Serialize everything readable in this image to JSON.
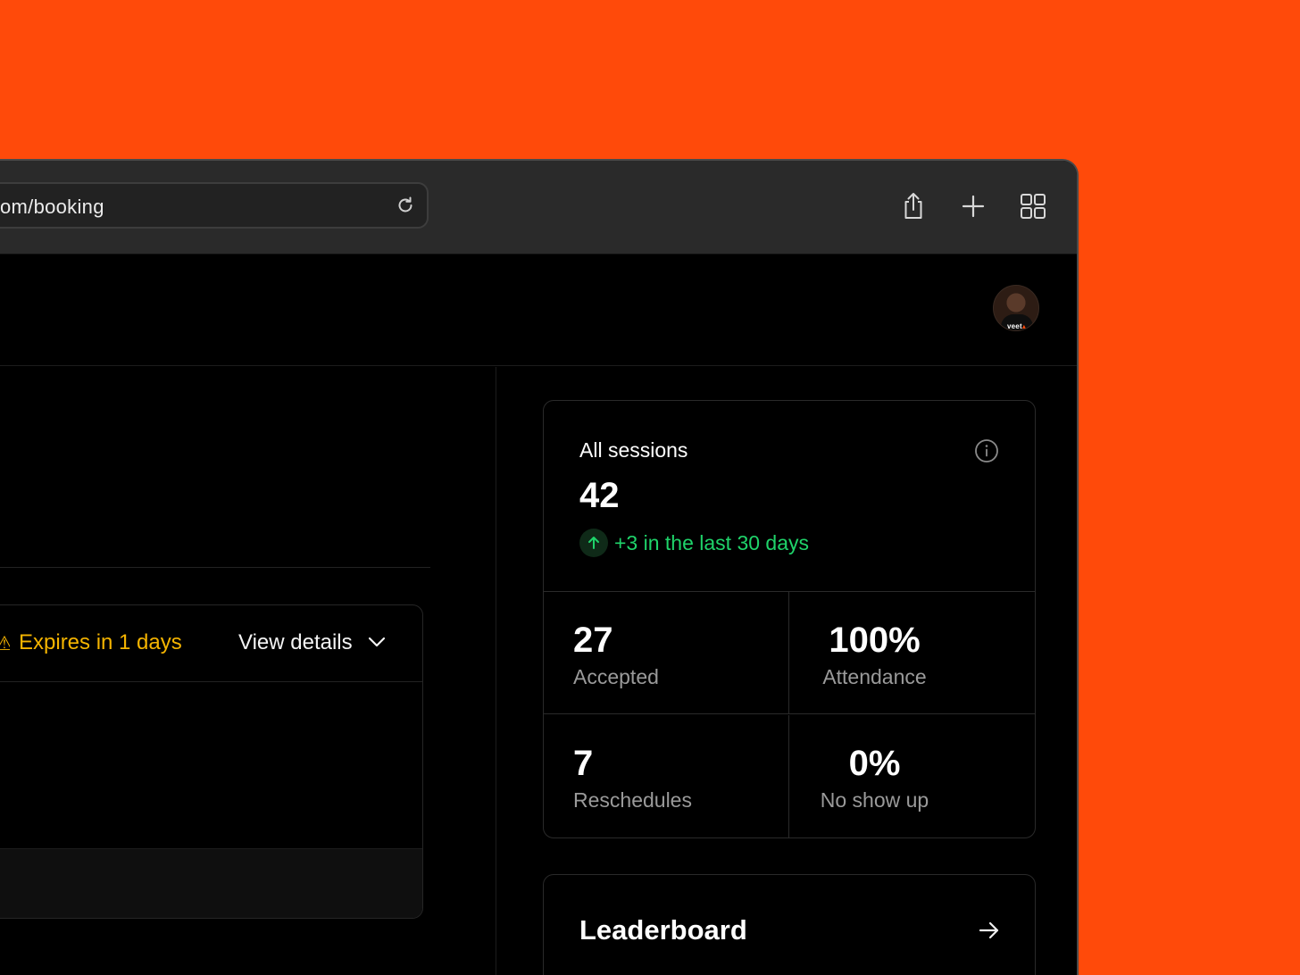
{
  "browser": {
    "url": "om/booking",
    "icons": [
      "reload-icon",
      "share-icon",
      "new-tab-icon",
      "tab-overview-icon"
    ]
  },
  "header": {
    "avatar_logo_text": "veet"
  },
  "offer": {
    "expires_text": "Expires in 1 days",
    "view_details_label": "View details",
    "accent_color": "#f5b400"
  },
  "stats": {
    "title": "All sessions",
    "total": "42",
    "trend": "+3 in the last 30 days",
    "trend_color": "#1fd36a",
    "cells": [
      {
        "value": "27",
        "label": "Accepted"
      },
      {
        "value": "100%",
        "label": "Attendance"
      },
      {
        "value": "7",
        "label": "Reschedules"
      },
      {
        "value": "0%",
        "label": "No show up"
      }
    ]
  },
  "leaderboard": {
    "title": "Leaderboard"
  },
  "colors": {
    "background": "#ff4a0a",
    "page": "#000000",
    "toolbar": "#2a2a2a"
  }
}
